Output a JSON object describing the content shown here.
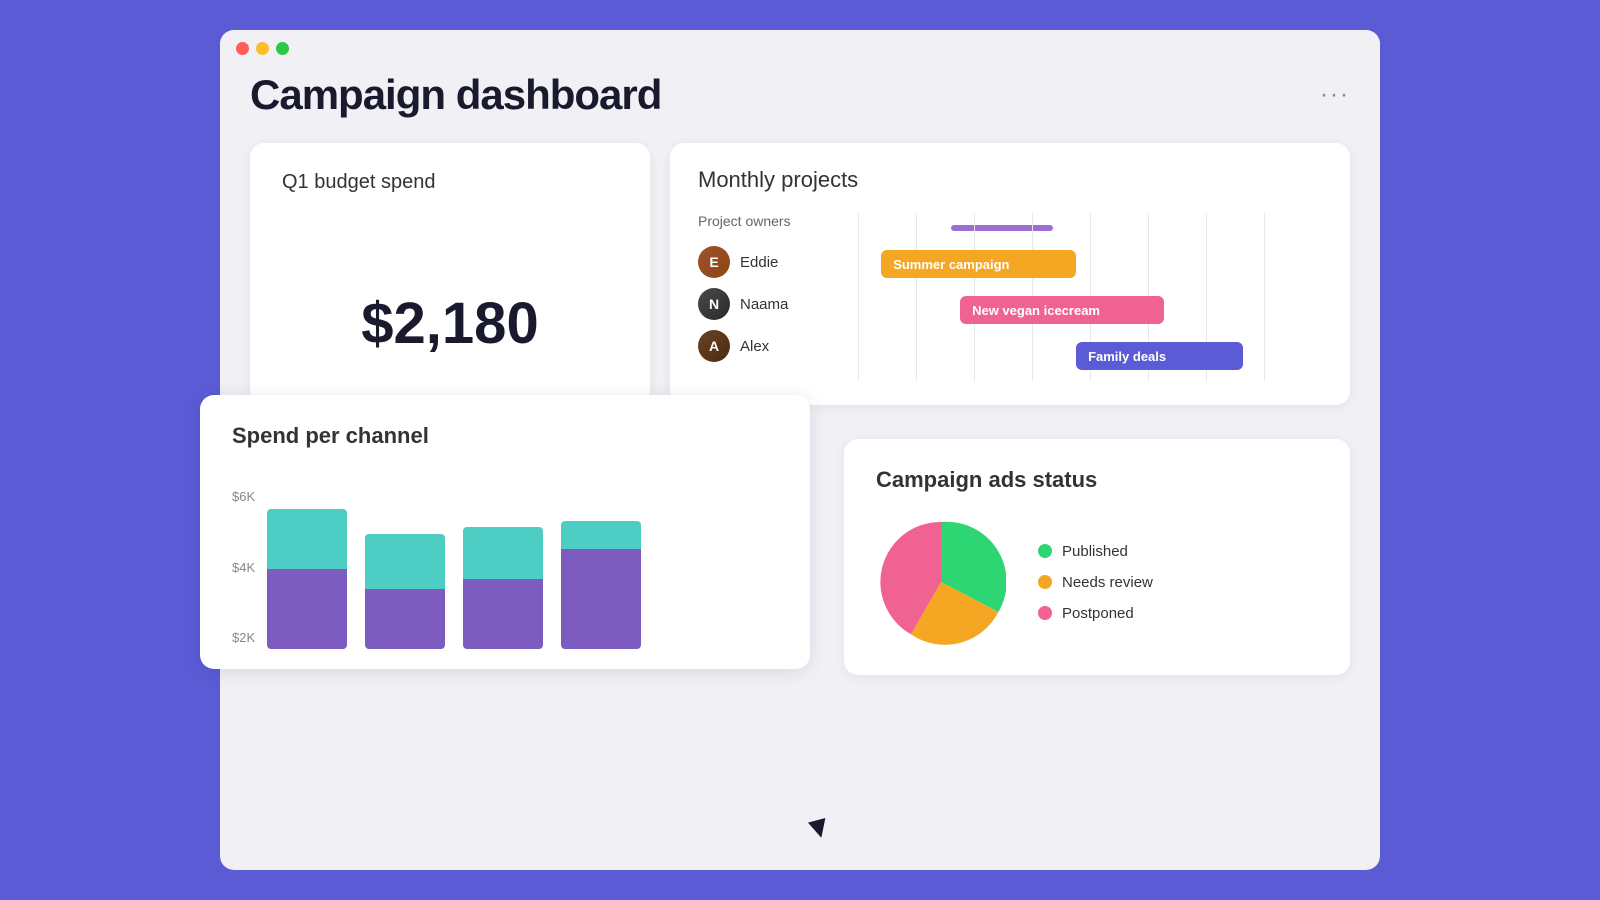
{
  "window": {
    "title": "Campaign dashboard"
  },
  "header": {
    "title": "Campaign dashboard",
    "more_label": "···"
  },
  "budget_card": {
    "title": "Q1 budget spend",
    "value": "$2,180"
  },
  "monthly_card": {
    "title": "Monthly projects",
    "owners_label": "Project owners",
    "owners": [
      {
        "name": "Eddie",
        "initials": "E"
      },
      {
        "name": "Naama",
        "initials": "N"
      },
      {
        "name": "Alex",
        "initials": "A"
      }
    ],
    "bars": [
      {
        "label": "Summer campaign",
        "color": "orange",
        "left_pct": 5,
        "width_pct": 40
      },
      {
        "label": "New vegan icecream",
        "color": "pink",
        "left_pct": 20,
        "width_pct": 45
      },
      {
        "label": "Family deals",
        "color": "blue",
        "left_pct": 45,
        "width_pct": 38
      }
    ]
  },
  "spend_card": {
    "title": "Spend per channel",
    "y_labels": [
      "$6K",
      "$4K",
      "$2K"
    ],
    "bars": [
      {
        "top_h": 60,
        "bot_h": 80
      },
      {
        "top_h": 55,
        "bot_h": 60
      },
      {
        "top_h": 52,
        "bot_h": 70
      },
      {
        "top_h": 30,
        "bot_h": 100
      }
    ]
  },
  "ads_card": {
    "title": "Campaign ads status",
    "legend": [
      {
        "label": "Published",
        "color": "green"
      },
      {
        "label": "Needs review",
        "color": "orange"
      },
      {
        "label": "Postponed",
        "color": "pink"
      }
    ],
    "pie": {
      "published_pct": 40,
      "needs_review_pct": 30,
      "postponed_pct": 30
    }
  },
  "colors": {
    "accent": "#5b5bd6",
    "teal": "#4ecdc4",
    "purple": "#7c5cbf",
    "orange": "#f5a623",
    "pink": "#f06292",
    "green": "#2ed573"
  }
}
